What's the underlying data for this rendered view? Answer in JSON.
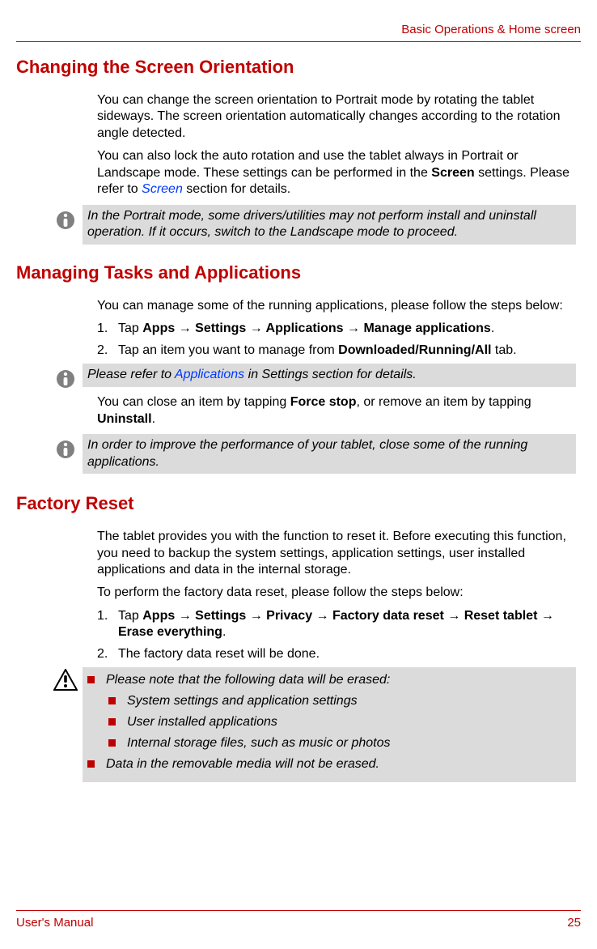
{
  "header": {
    "breadcrumb": "Basic Operations & Home screen"
  },
  "section1": {
    "heading": "Changing the Screen Orientation",
    "para1": "You can change the screen orientation to Portrait mode by rotating the tablet sideways. The screen orientation automatically changes according to the rotation angle detected.",
    "para2_pre": "You can also lock the auto rotation and use the tablet always in Portrait or Landscape mode. These settings can be performed in the ",
    "para2_bold": "Screen",
    "para2_mid": " settings. Please refer to ",
    "para2_link": "Screen",
    "para2_post": " section for details.",
    "note1": "In the Portrait mode, some drivers/utilities may not perform install and uninstall operation. If it occurs, switch to the Landscape mode to proceed."
  },
  "section2": {
    "heading": "Managing Tasks and Applications",
    "para1": "You can manage some of the running applications, please follow the steps below:",
    "step1_num": "1.",
    "step1_pre": "Tap ",
    "step1_bold": "Apps → Settings → Applications → Manage applications",
    "step1_post": ".",
    "step2_num": "2.",
    "step2_pre": "Tap an item you want to manage from ",
    "step2_bold": "Downloaded/Running/All",
    "step2_post": " tab.",
    "note1_pre": "Please refer to ",
    "note1_link": "Applications",
    "note1_post": " in Settings section for details.",
    "para2_pre": "You can close an item by tapping ",
    "para2_bold1": "Force stop",
    "para2_mid": ", or remove an item by tapping ",
    "para2_bold2": "Uninstall",
    "para2_post": ".",
    "note2": "In order to improve the performance of your tablet, close some of the running applications."
  },
  "section3": {
    "heading": "Factory Reset",
    "para1": "The tablet provides you with the function to reset it. Before executing this function, you need to backup the system settings, application settings, user installed applications and data in the internal storage.",
    "para2": "To perform the factory data reset, please follow the steps below:",
    "step1_num": "1.",
    "step1_pre": "Tap ",
    "step1_bold": "Apps → Settings → Privacy → Factory data reset → Reset tablet → Erase everything",
    "step1_post": ".",
    "step2_num": "2.",
    "step2_txt": "The factory data reset will be done.",
    "caution": {
      "line1": "Please note that the following data will be erased:",
      "sub1": "System settings and application settings",
      "sub2": "User installed applications",
      "sub3": "Internal storage files, such as music or photos",
      "line2": "Data in the removable media will not be erased."
    }
  },
  "footer": {
    "left": "User's Manual",
    "right": "25"
  }
}
